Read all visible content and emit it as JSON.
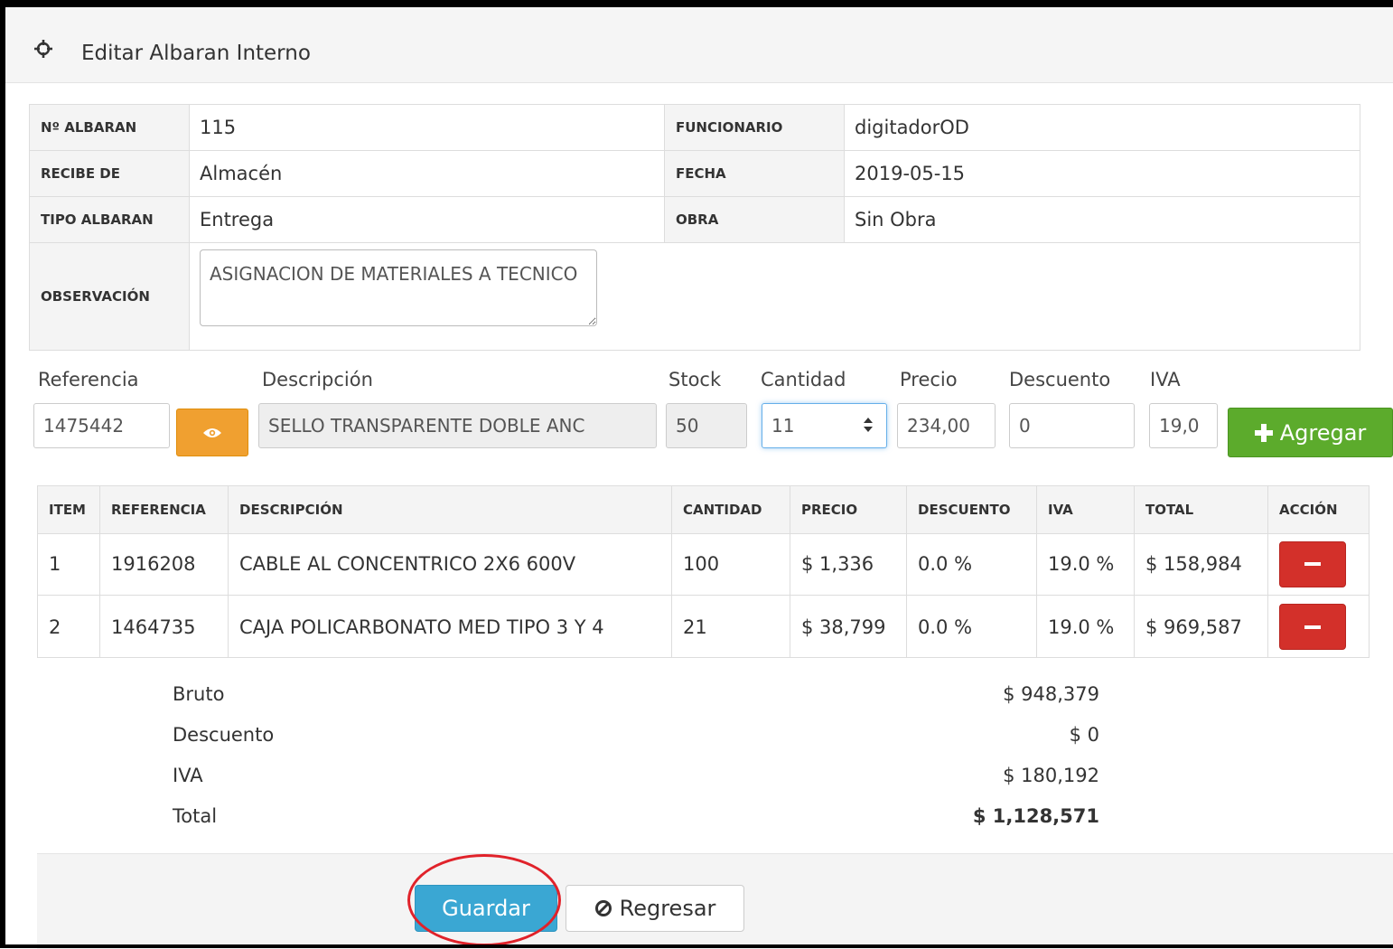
{
  "header": {
    "title": "Editar Albaran Interno"
  },
  "info": {
    "albaran_label": "Nº ALBARAN",
    "albaran_value": "115",
    "funcionario_label": "FUNCIONARIO",
    "funcionario_value": "digitadorOD",
    "recibe_label": "RECIBE DE",
    "recibe_value": "Almacén",
    "fecha_label": "FECHA",
    "fecha_value": "2019-05-15",
    "tipo_label": "TIPO ALBARAN",
    "tipo_value": "Entrega",
    "obra_label": "OBRA",
    "obra_value": "Sin Obra",
    "observacion_label": "OBSERVACIÓN",
    "observacion_value": "ASIGNACION DE MATERIALES A TECNICO"
  },
  "form": {
    "referencia_label": "Referencia",
    "referencia_value": "1475442",
    "descripcion_label": "Descripción",
    "descripcion_value": "SELLO TRANSPARENTE DOBLE ANC",
    "stock_label": "Stock",
    "stock_value": "50",
    "cantidad_label": "Cantidad",
    "cantidad_value": "11",
    "precio_label": "Precio",
    "precio_value": "234,00",
    "descuento_label": "Descuento",
    "descuento_value": "0",
    "iva_label": "IVA",
    "iva_value": "19,0",
    "add_label": "Agregar"
  },
  "items": {
    "headers": {
      "item": "ITEM",
      "referencia": "REFERENCIA",
      "descripcion": "DESCRIPCIÓN",
      "cantidad": "CANTIDAD",
      "precio": "PRECIO",
      "descuento": "DESCUENTO",
      "iva": "IVA",
      "total": "TOTAL",
      "accion": "ACCIÓN"
    },
    "rows": [
      {
        "item": "1",
        "referencia": "1916208",
        "descripcion": "CABLE AL CONCENTRICO 2X6 600V",
        "cantidad": "100",
        "precio": "$ 1,336",
        "descuento": "0.0 %",
        "iva": "19.0 %",
        "total": "$ 158,984"
      },
      {
        "item": "2",
        "referencia": "1464735",
        "descripcion": "CAJA POLICARBONATO MED TIPO 3 Y 4",
        "cantidad": "21",
        "precio": "$ 38,799",
        "descuento": "0.0 %",
        "iva": "19.0 %",
        "total": "$ 969,587"
      }
    ]
  },
  "totals": {
    "bruto_label": "Bruto",
    "bruto_value": "$ 948,379",
    "descuento_label": "Descuento",
    "descuento_value": "$ 0",
    "iva_label": "IVA",
    "iva_value": "$ 180,192",
    "total_label": "Total",
    "total_value": "$ 1,128,571"
  },
  "footer": {
    "save_label": "Guardar",
    "back_label": "Regresar"
  },
  "colors": {
    "add_button": "#5cab2c",
    "remove_button": "#d3302a",
    "save_button": "#3aa7d3",
    "eye_button": "#f0a030",
    "highlight": "#e0222a"
  },
  "icons": [
    "crosshair-icon",
    "eye-icon",
    "plus-icon",
    "minus-icon",
    "ban-icon",
    "spinner-icon"
  ]
}
